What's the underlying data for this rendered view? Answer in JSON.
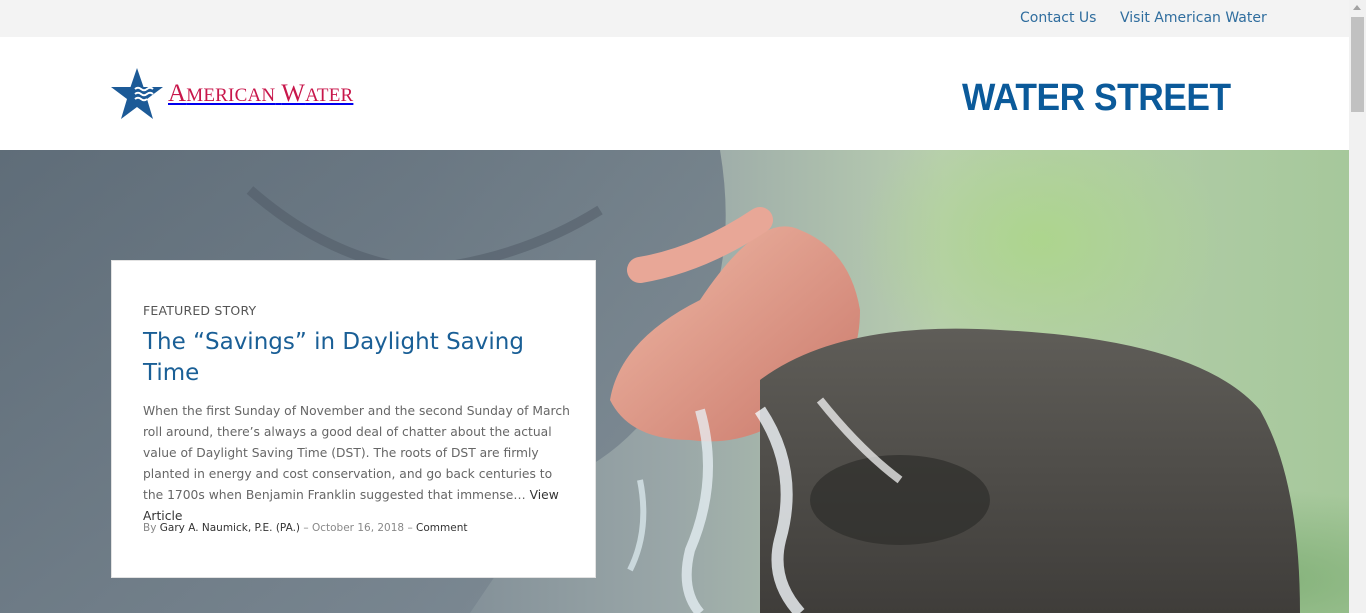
{
  "topbar": {
    "contact": "Contact Us",
    "visit": "Visit American Water"
  },
  "header": {
    "logo_text_large_1": "A",
    "logo_text_small_1": "MERICAN",
    "logo_text_large_2": "W",
    "logo_text_small_2": "ATER",
    "brand_title": "WATER STREET",
    "logo_icon": "star-wave-icon"
  },
  "featured": {
    "kicker": "FEATURED STORY",
    "title": "The “Savings” in Daylight Saving Time",
    "excerpt": "When the first Sunday of November and the second Sunday of March roll around, there’s always a good deal of chatter about the actual value of Daylight Saving Time (DST). The roots of DST are firmly planted in energy and cost conservation, and go back centuries to the 1700s when Benjamin Franklin suggested that immense…",
    "read_more": "View Article",
    "meta_by": "By",
    "author": "Gary A. Naumick, P.E. (PA.)",
    "date_sep": "–",
    "date": "October 16, 2018",
    "comment_sep": "–",
    "comment": "Comment"
  },
  "colors": {
    "accent_blue": "#1a5f96",
    "brand_blue": "#0b5a9a",
    "logo_red": "#c8174b",
    "topbar_bg": "#f3f3f3"
  }
}
